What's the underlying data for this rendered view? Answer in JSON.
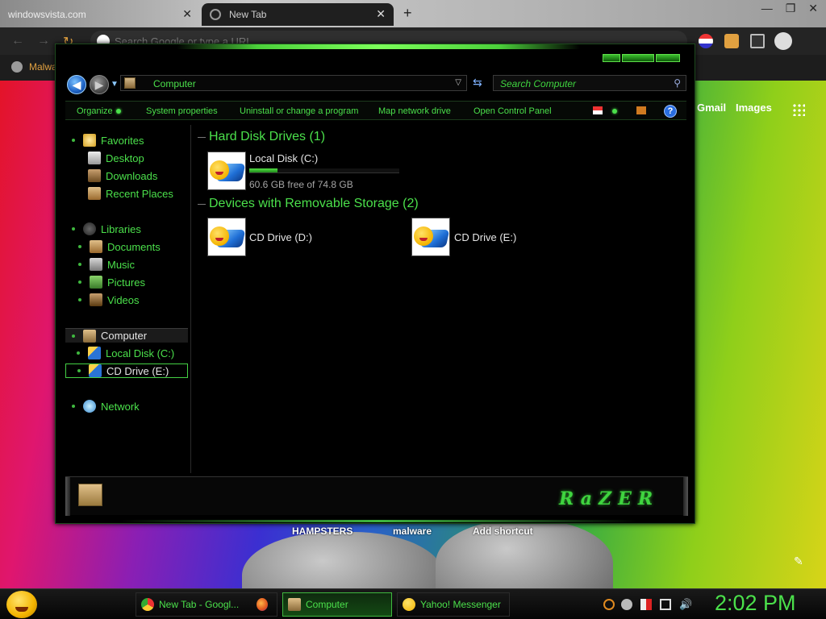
{
  "browser": {
    "tabs": [
      {
        "title": "windowsvista.com"
      },
      {
        "title": "New Tab"
      }
    ],
    "new_tab": "+",
    "omnibox_placeholder": "Search Google or type a URL",
    "bookmark_label": "Malwa",
    "links": {
      "gmail": "Gmail",
      "images": "Images"
    },
    "shortcuts": [
      "HAMPSTERS",
      "malware",
      "Add shortcut"
    ]
  },
  "explorer": {
    "address": "Computer",
    "search_placeholder": "Search Computer",
    "commands": [
      "Organize",
      "System properties",
      "Uninstall or change a program",
      "Map network drive",
      "Open Control Panel"
    ],
    "help": "?",
    "nav": {
      "favorites": "Favorites",
      "desktop": "Desktop",
      "downloads": "Downloads",
      "recent": "Recent Places",
      "libraries": "Libraries",
      "documents": "Documents",
      "music": "Music",
      "pictures": "Pictures",
      "videos": "Videos",
      "computer": "Computer",
      "local_disk": "Local Disk (C:)",
      "cd_drive": "CD Drive (E:)",
      "network": "Network"
    },
    "groups": {
      "hdd": "Hard Disk Drives (1)",
      "removable": "Devices with Removable Storage (2)"
    },
    "drives": {
      "c": {
        "name": "Local Disk (C:)",
        "free": "60.6 GB free of 74.8 GB",
        "used_fraction": 0.19
      },
      "d": {
        "name": "CD Drive (D:)"
      },
      "e": {
        "name": "CD Drive (E:)"
      }
    },
    "brand": "RaZER"
  },
  "taskbar": {
    "items": [
      "New Tab - Googl...",
      "Computer",
      "Yahoo! Messenger"
    ],
    "clock": "2:02 PM"
  },
  "colors": {
    "accent": "#4be04b"
  }
}
